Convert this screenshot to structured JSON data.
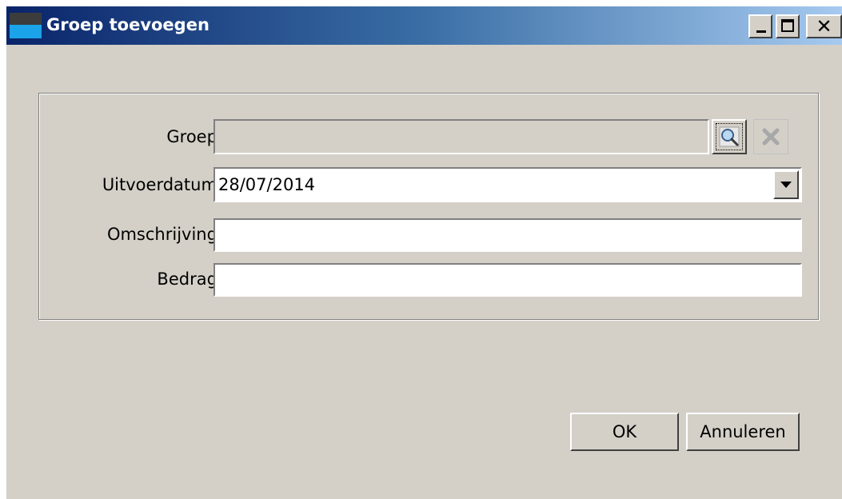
{
  "window": {
    "title": "Groep toevoegen",
    "controls": {
      "minimize": "_",
      "close": "✕"
    }
  },
  "form": {
    "groep": {
      "label": "Groep:",
      "value": ""
    },
    "uitvoerdatum": {
      "label": "Uitvoerdatum:",
      "value": "28/07/2014"
    },
    "omschrijving": {
      "label": "Omschrijving:",
      "value": ""
    },
    "bedrag": {
      "label": "Bedrag:",
      "value": ""
    }
  },
  "buttons": {
    "ok": "OK",
    "cancel": "Annuleren"
  },
  "icons": {
    "search": "magnifier-icon",
    "clear": "clear-x-icon",
    "dropdown": "chevron-down-icon"
  },
  "colors": {
    "window_bg": "#d4d0c8",
    "title_start": "#0a246a",
    "title_end": "#a6caf0"
  }
}
